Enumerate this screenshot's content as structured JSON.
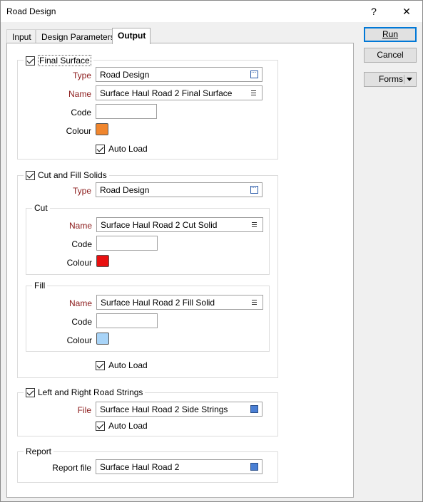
{
  "window": {
    "title": "Road Design",
    "help": "?",
    "close": "✕"
  },
  "tabs": [
    {
      "label": "Input"
    },
    {
      "label": "Design Parameters"
    },
    {
      "label": "Output"
    }
  ],
  "buttons": {
    "run": "Run",
    "cancel": "Cancel",
    "forms": "Forms"
  },
  "final_surface": {
    "title": "Final Surface",
    "checked": true,
    "type_label": "Type",
    "type_value": "Road Design",
    "name_label": "Name",
    "name_value": "Surface Haul Road 2 Final Surface",
    "code_label": "Code",
    "code_value": "",
    "colour_label": "Colour",
    "colour": "#f0862e",
    "autoload_label": "Auto Load"
  },
  "cut_fill": {
    "title": "Cut and Fill Solids",
    "type_label": "Type",
    "type_value": "Road Design",
    "cut": {
      "title": "Cut",
      "name_label": "Name",
      "name_value": "Surface Haul Road 2 Cut Solid",
      "code_label": "Code",
      "code_value": "",
      "colour_label": "Colour",
      "colour": "#e81010"
    },
    "fill": {
      "title": "Fill",
      "name_label": "Name",
      "name_value": "Surface Haul Road 2 Fill Solid",
      "code_label": "Code",
      "code_value": "",
      "colour_label": "Colour",
      "colour": "#a8d4f8"
    },
    "autoload_label": "Auto Load"
  },
  "strings": {
    "title": "Left and Right Road Strings",
    "file_label": "File",
    "file_value": "Surface Haul Road 2 Side Strings",
    "autoload_label": "Auto Load"
  },
  "report": {
    "title": "Report",
    "file_label": "Report file",
    "file_value": "Surface Haul Road 2"
  }
}
